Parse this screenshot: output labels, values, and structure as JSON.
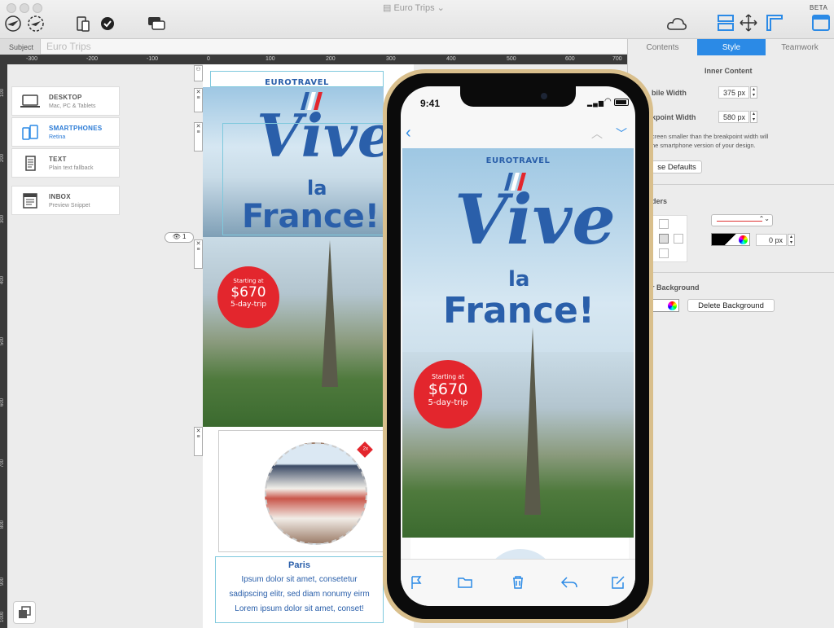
{
  "window": {
    "title": "Euro Trips",
    "badge": "BETA"
  },
  "subject": {
    "label": "Subject",
    "value": "Euro Trips"
  },
  "ruler": {
    "ticks": [
      "-300",
      "-200",
      "-100",
      "0",
      "100",
      "200",
      "300",
      "400",
      "500",
      "600",
      "700"
    ]
  },
  "vruler": {
    "ticks": [
      "100",
      "200",
      "300",
      "400",
      "500",
      "600",
      "700",
      "800",
      "900",
      "1000"
    ]
  },
  "devices": [
    {
      "label": "DESKTOP",
      "sub": "Mac, PC & Tablets"
    },
    {
      "label": "SMARTPHONES",
      "sub": "Retina"
    },
    {
      "label": "TEXT",
      "sub": "Plain text fallback"
    },
    {
      "label": "INBOX",
      "sub": "Preview Snippet"
    }
  ],
  "canvas": {
    "brand": "EUROTRAVEL",
    "title_script": "Vive",
    "title_small": "la",
    "title_big": "France!",
    "badge_line1": "Starting at",
    "badge_price": "$670",
    "badge_line2": "5-day-trip",
    "eye_count": "1",
    "tag_2x": "2x",
    "city": "Paris",
    "lorem1": "Ipsum dolor sit amet, consetetur",
    "lorem2": "sadipscing elitr, sed diam nonumy eirm",
    "lorem3": "Lorem ipsum dolor sit amet, conset!"
  },
  "panel": {
    "tabs": [
      "Contents",
      "Style",
      "Teamwork"
    ],
    "section_inner": "Inner Content",
    "mobile_width_label": "bile Width",
    "mobile_width_value": "375 px",
    "breakpoint_label": "kpoint Width",
    "breakpoint_value": "580 px",
    "hint": "creen smaller than the breakpoint width will\nhe smartphone version of your design.",
    "defaults_btn": "se Defaults",
    "borders_label": "ders",
    "border_width_value": "0 px",
    "bg_label": "r Background",
    "delete_bg_btn": "Delete Background"
  },
  "phone": {
    "time": "9:41",
    "brand": "EUROTRAVEL",
    "title_script": "Vive",
    "title_small": "la",
    "title_big": "France!",
    "badge_line1": "Starting at",
    "badge_price": "$670",
    "badge_line2": "5-day-trip"
  },
  "colors": {
    "accent": "#2b8ae6",
    "brand": "#2a5faa",
    "badge": "#e3262d",
    "phone_frame": "#d9bf8c"
  }
}
